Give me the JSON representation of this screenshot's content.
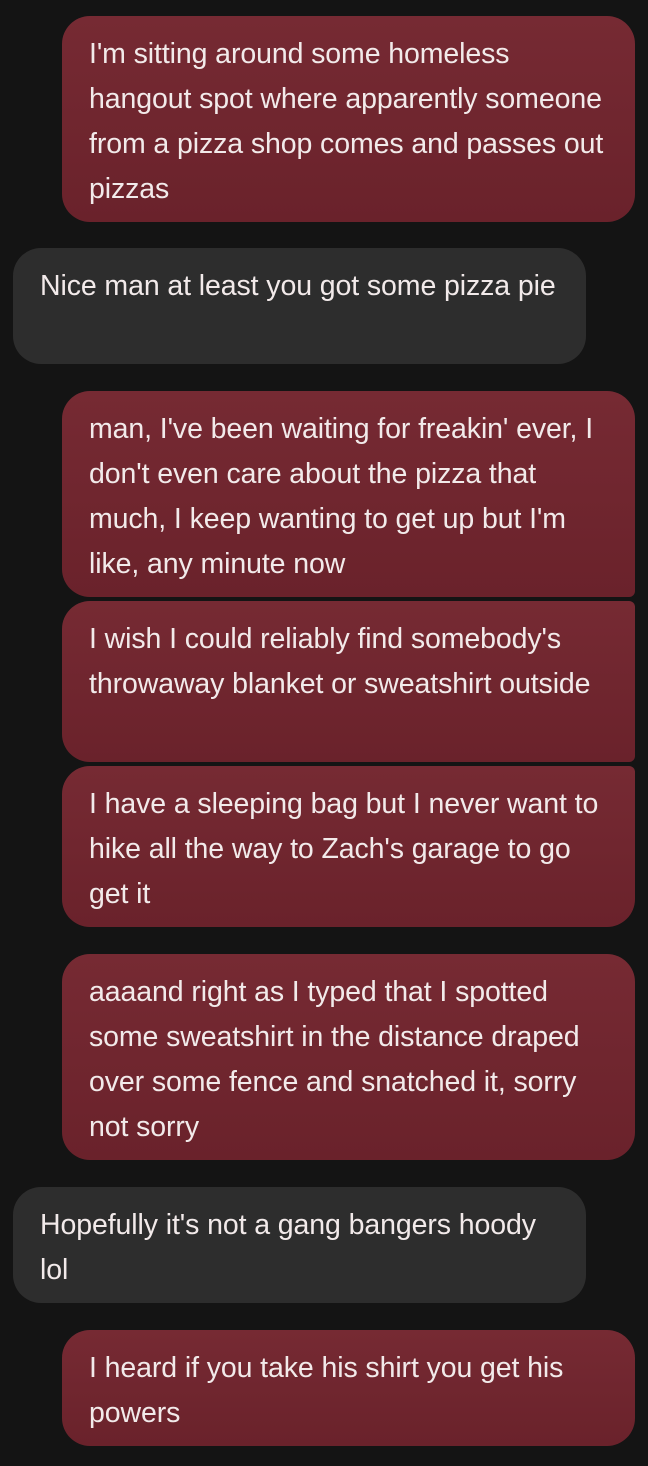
{
  "colors": {
    "background": "#141414",
    "outgoing_bubble": "#702630",
    "incoming_bubble": "#2d2d2d",
    "text": "#f2eaea"
  },
  "messages": [
    {
      "direction": "outgoing",
      "text": "I'm sitting around some homeless hangout spot where apparently someone from a pizza shop comes and passes out pizzas"
    },
    {
      "direction": "incoming",
      "text": "Nice man at least you got some pizza pie"
    },
    {
      "direction": "outgoing",
      "text": "man, I've been waiting for freakin' ever, I don't even care about the pizza that much, I keep wanting to get up but I'm like, any minute now"
    },
    {
      "direction": "outgoing",
      "text": "I wish I could reliably find somebody's throwaway blanket or sweatshirt outside"
    },
    {
      "direction": "outgoing",
      "text": "I have a sleeping bag but I never want to hike all the way to Zach's garage to go get it"
    },
    {
      "direction": "outgoing",
      "text": "aaaand right as I typed that I spotted some sweatshirt in the distance draped over some fence and snatched it, sorry not sorry"
    },
    {
      "direction": "incoming",
      "text": "Hopefully it's not a gang bangers hoody lol"
    },
    {
      "direction": "outgoing",
      "text": "I heard if you take his shirt you get his powers"
    }
  ]
}
